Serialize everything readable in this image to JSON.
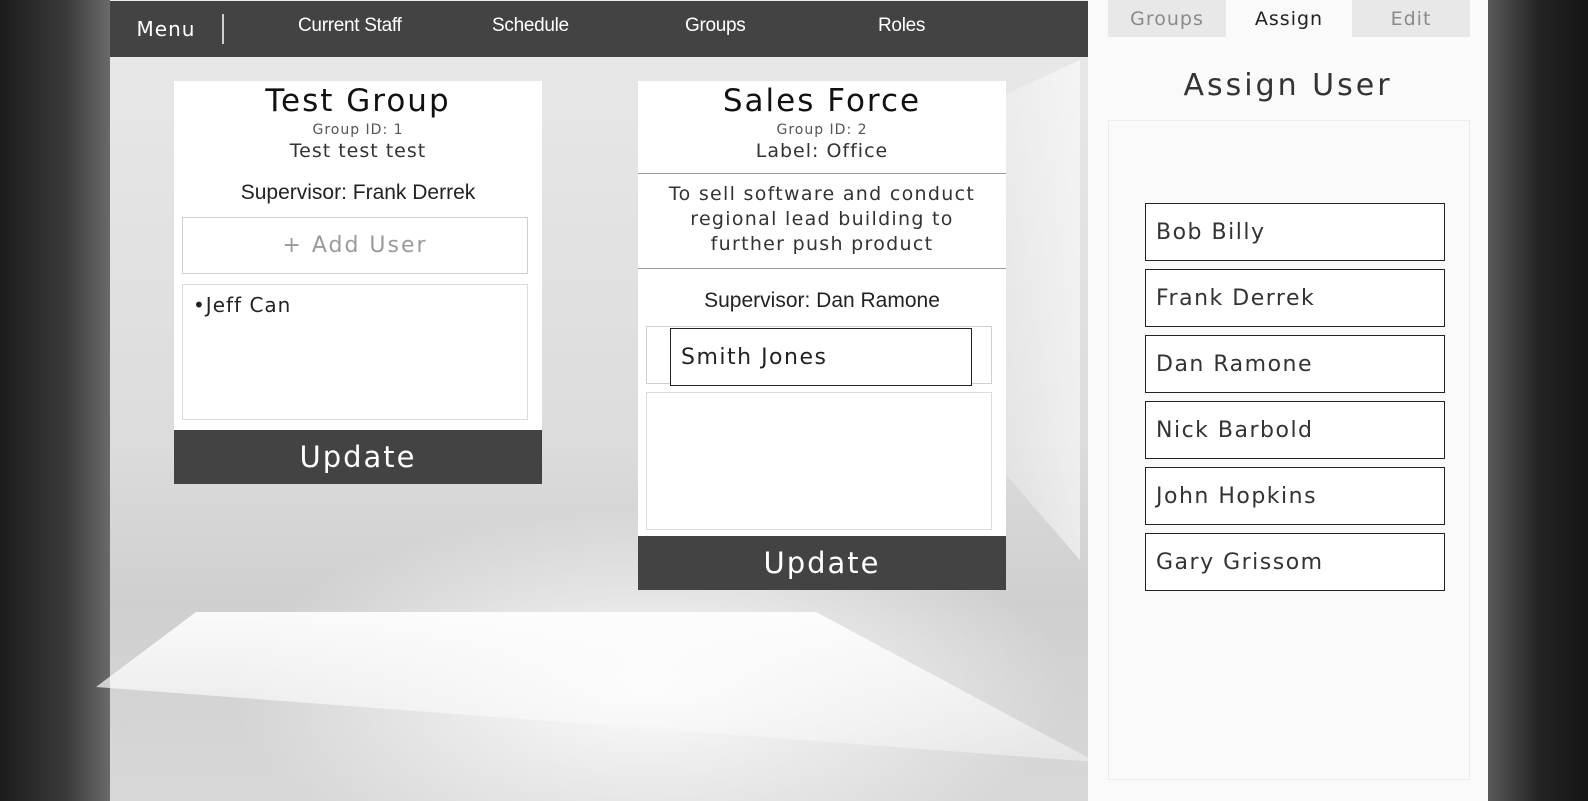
{
  "nav": {
    "menu": "Menu",
    "items": [
      "Current Staff",
      "Schedule",
      "Groups",
      "Roles"
    ]
  },
  "groups": [
    {
      "title": "Test Group",
      "group_id": "Group ID: 1",
      "subtitle": "Test test test",
      "supervisor": "Supervisor: Frank Derrek",
      "add_user": "+ Add User",
      "members": [
        "•Jeff Can"
      ],
      "update": "Update"
    },
    {
      "title": "Sales Force",
      "group_id": "Group ID: 2",
      "label": "Label: Office",
      "description": "To sell software and conduct regional lead building to further push product",
      "supervisor": "Supervisor: Dan Ramone",
      "dragging_user": "Smith Jones",
      "update": "Update"
    }
  ],
  "panel": {
    "tabs": [
      "Groups",
      "Assign",
      "Edit"
    ],
    "active_tab": "Assign",
    "heading": "Assign User",
    "users": [
      "Bob Billy",
      "Frank Derrek",
      "Dan Ramone",
      "Nick Barbold",
      "John Hopkins",
      "Gary Grissom"
    ]
  }
}
